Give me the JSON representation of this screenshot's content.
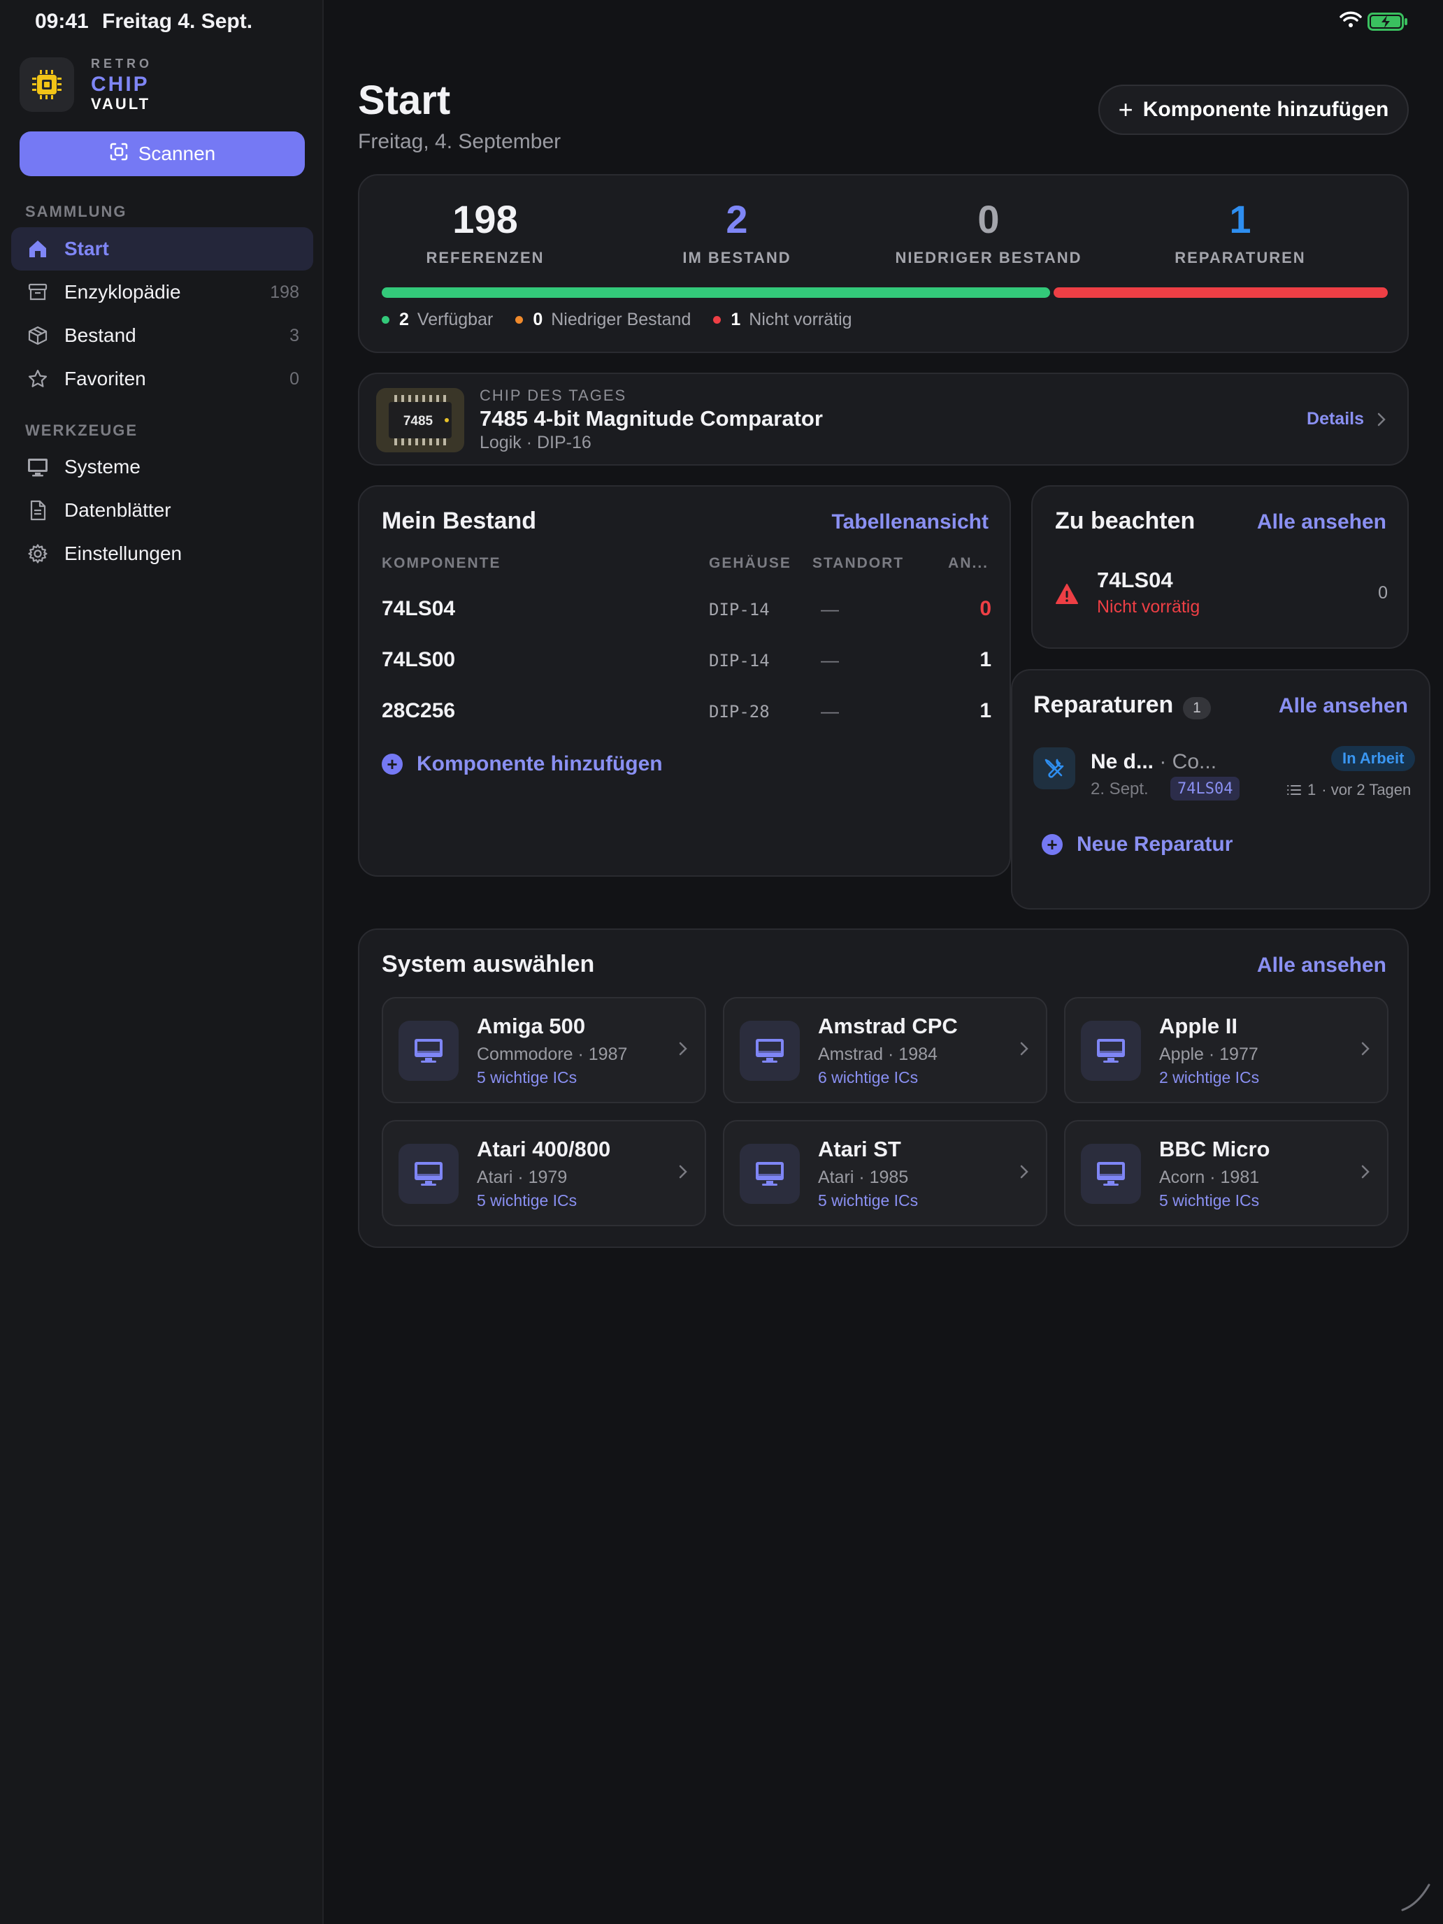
{
  "status_bar": {
    "time": "09:41",
    "date": "Freitag 4. Sept."
  },
  "brand": {
    "line1": "RETRO",
    "line2": "CHIP",
    "line3": "VAULT"
  },
  "sidebar": {
    "scan_label": "Scannen",
    "section_collection": "SAMMLUNG",
    "section_tools": "WERKZEUGE",
    "items": [
      {
        "label": "Start",
        "icon": "house-icon",
        "count": ""
      },
      {
        "label": "Enzyklopädie",
        "icon": "archive-box-icon",
        "count": "198"
      },
      {
        "label": "Bestand",
        "icon": "cube-icon",
        "count": "3"
      },
      {
        "label": "Favoriten",
        "icon": "star-icon",
        "count": "0"
      }
    ],
    "tools": [
      {
        "label": "Systeme",
        "icon": "monitor-icon"
      },
      {
        "label": "Datenblätter",
        "icon": "document-icon"
      },
      {
        "label": "Einstellungen",
        "icon": "gear-icon"
      }
    ]
  },
  "header": {
    "title": "Start",
    "subtitle": "Freitag, 4. September",
    "add_button": "Komponente hinzufügen"
  },
  "stats": {
    "items": [
      {
        "value": "198",
        "label": "REFERENZEN",
        "color": "#ffffff"
      },
      {
        "value": "2",
        "label": "IM BESTAND",
        "color": "#7f86f6"
      },
      {
        "value": "0",
        "label": "NIEDRIGER BESTAND",
        "color": "#a4a5ac"
      },
      {
        "value": "1",
        "label": "REPARATUREN",
        "color": "#2e8ef0"
      }
    ],
    "legend": [
      {
        "count": "2",
        "label": "Verfügbar",
        "color": "#33c97a"
      },
      {
        "count": "0",
        "label": "Niedriger Bestand",
        "color": "#f08a2c"
      },
      {
        "count": "1",
        "label": "Nicht vorrätig",
        "color": "#ee3f45"
      }
    ],
    "available_fraction": 0.667
  },
  "chip_of_day": {
    "label": "CHIP DES TAGES",
    "chip_marking": "7485",
    "name": "7485 4-bit Magnitude Comparator",
    "meta": "Logik · DIP-16",
    "details": "Details"
  },
  "inventory": {
    "title": "Mein Bestand",
    "link": "Tabellenansicht",
    "columns": [
      "KOMPONENTE",
      "GEHÄUSE",
      "STANDORT",
      "AN..."
    ],
    "rows": [
      {
        "part": "74LS04",
        "package": "DIP-14",
        "location": "—",
        "qty": "0",
        "qty_color": "#ee3f45"
      },
      {
        "part": "74LS00",
        "package": "DIP-14",
        "location": "—",
        "qty": "1",
        "qty_color": "#ffffff"
      },
      {
        "part": "28C256",
        "package": "DIP-28",
        "location": "—",
        "qty": "1",
        "qty_color": "#ffffff"
      }
    ],
    "add_label": "Komponente hinzufügen"
  },
  "attention": {
    "title": "Zu beachten",
    "link": "Alle ansehen",
    "item": {
      "part": "74LS04",
      "status": "Nicht vorrätig",
      "count": "0"
    }
  },
  "repairs": {
    "title": "Reparaturen",
    "badge": "1",
    "link": "Alle ansehen",
    "item": {
      "title": "Ne d...",
      "subtitle": "· Co...",
      "date": "2. Sept.",
      "tag": "74LS04",
      "status": "In Arbeit",
      "steps": "1",
      "ago": "· vor 2 Tagen"
    },
    "new_label": "Neue Reparatur"
  },
  "systems": {
    "title": "System auswählen",
    "link": "Alle ansehen",
    "tiles": [
      {
        "name": "Amiga 500",
        "meta": "Commodore · 1987",
        "ics": "5 wichtige ICs"
      },
      {
        "name": "Amstrad CPC",
        "meta": "Amstrad · 1984",
        "ics": "6 wichtige ICs"
      },
      {
        "name": "Apple II",
        "meta": "Apple · 1977",
        "ics": "2 wichtige ICs"
      },
      {
        "name": "Atari 400/800",
        "meta": "Atari · 1979",
        "ics": "5 wichtige ICs"
      },
      {
        "name": "Atari ST",
        "meta": "Atari · 1985",
        "ics": "5 wichtige ICs"
      },
      {
        "name": "BBC Micro",
        "meta": "Acorn · 1981",
        "ics": "5 wichtige ICs"
      }
    ]
  },
  "colors": {
    "accent": "#7579f4",
    "danger": "#ee3f45",
    "success": "#33c97a",
    "info": "#2e8ef0"
  }
}
